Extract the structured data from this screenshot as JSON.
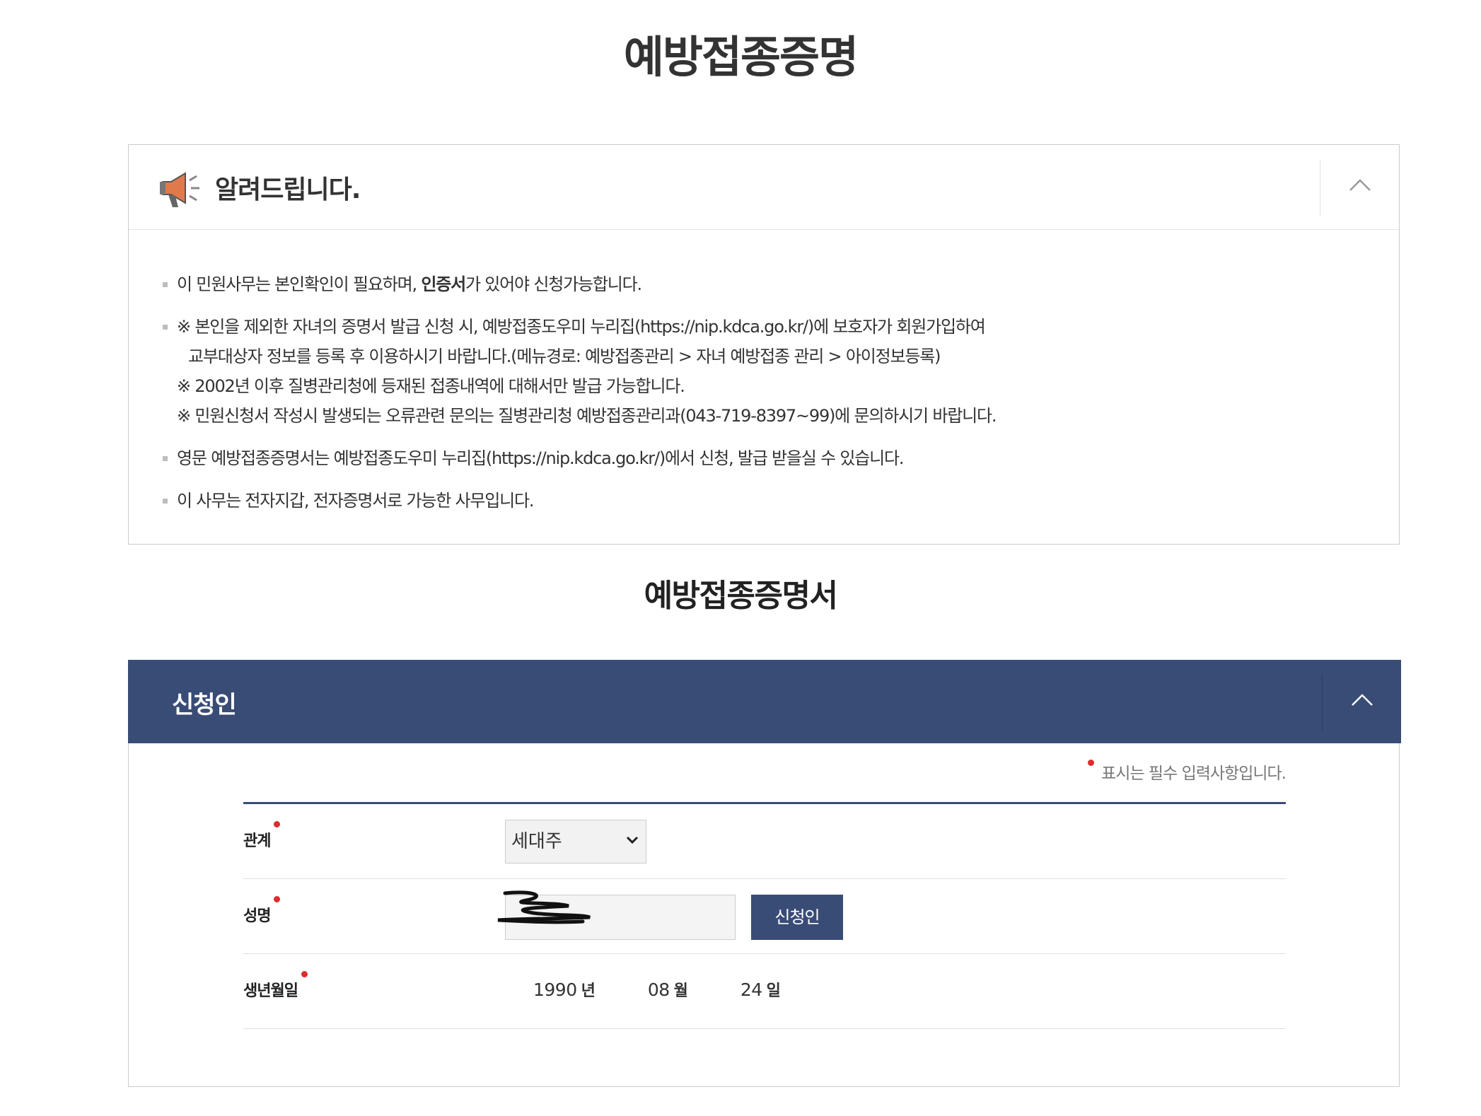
{
  "page": {
    "title": "예방접종증명"
  },
  "notice": {
    "title": "알려드립니다.",
    "items": [
      {
        "text_before": "이 민원사무는 본인확인이 필요하며, ",
        "bold": "인증서",
        "text_after": "가 있어야 신청가능합니다."
      },
      {
        "line1": "※ 본인을 제외한 자녀의 증명서 발급 신청 시, 예방접종도우미 누리집(https://nip.kdca.go.kr/)에 보호자가 회원가입하여",
        "line2": "교부대상자 정보를 등록 후 이용하시기 바랍니다.(메뉴경로: 예방접종관리 > 자녀 예방접종 관리 > 아이정보등록)",
        "line3": "※ 2002년 이후 질병관리청에 등재된 접종내역에 대해서만 발급 가능합니다.",
        "line4": "※ 민원신청서 작성시 발생되는 오류관련 문의는 질병관리청 예방접종관리과(043-719-8397~99)에 문의하시기 바랍니다."
      },
      {
        "text": "영문 예방접종증명서는 예방접종도우미 누리집(https://nip.kdca.go.kr/)에서 신청, 발급 받을실 수 있습니다."
      },
      {
        "text": "이 사무는 전자지갑, 전자증명서로 가능한 사무입니다."
      }
    ]
  },
  "section": {
    "title": "예방접종증명서"
  },
  "applicant": {
    "title": "신청인",
    "required_note": "표시는 필수 입력사항입니다.",
    "relation": {
      "label": "관계",
      "selected": "세대주"
    },
    "name": {
      "label": "성명",
      "value": "",
      "button_label": "신청인"
    },
    "birth": {
      "label": "생년월일",
      "year": "1990",
      "year_unit": "년",
      "month": "08",
      "month_unit": "월",
      "day": "24",
      "day_unit": "일"
    }
  },
  "colors": {
    "header_navy": "#394c76",
    "required_red": "#e02b2b",
    "megaphone_orange": "#e07a4a"
  }
}
